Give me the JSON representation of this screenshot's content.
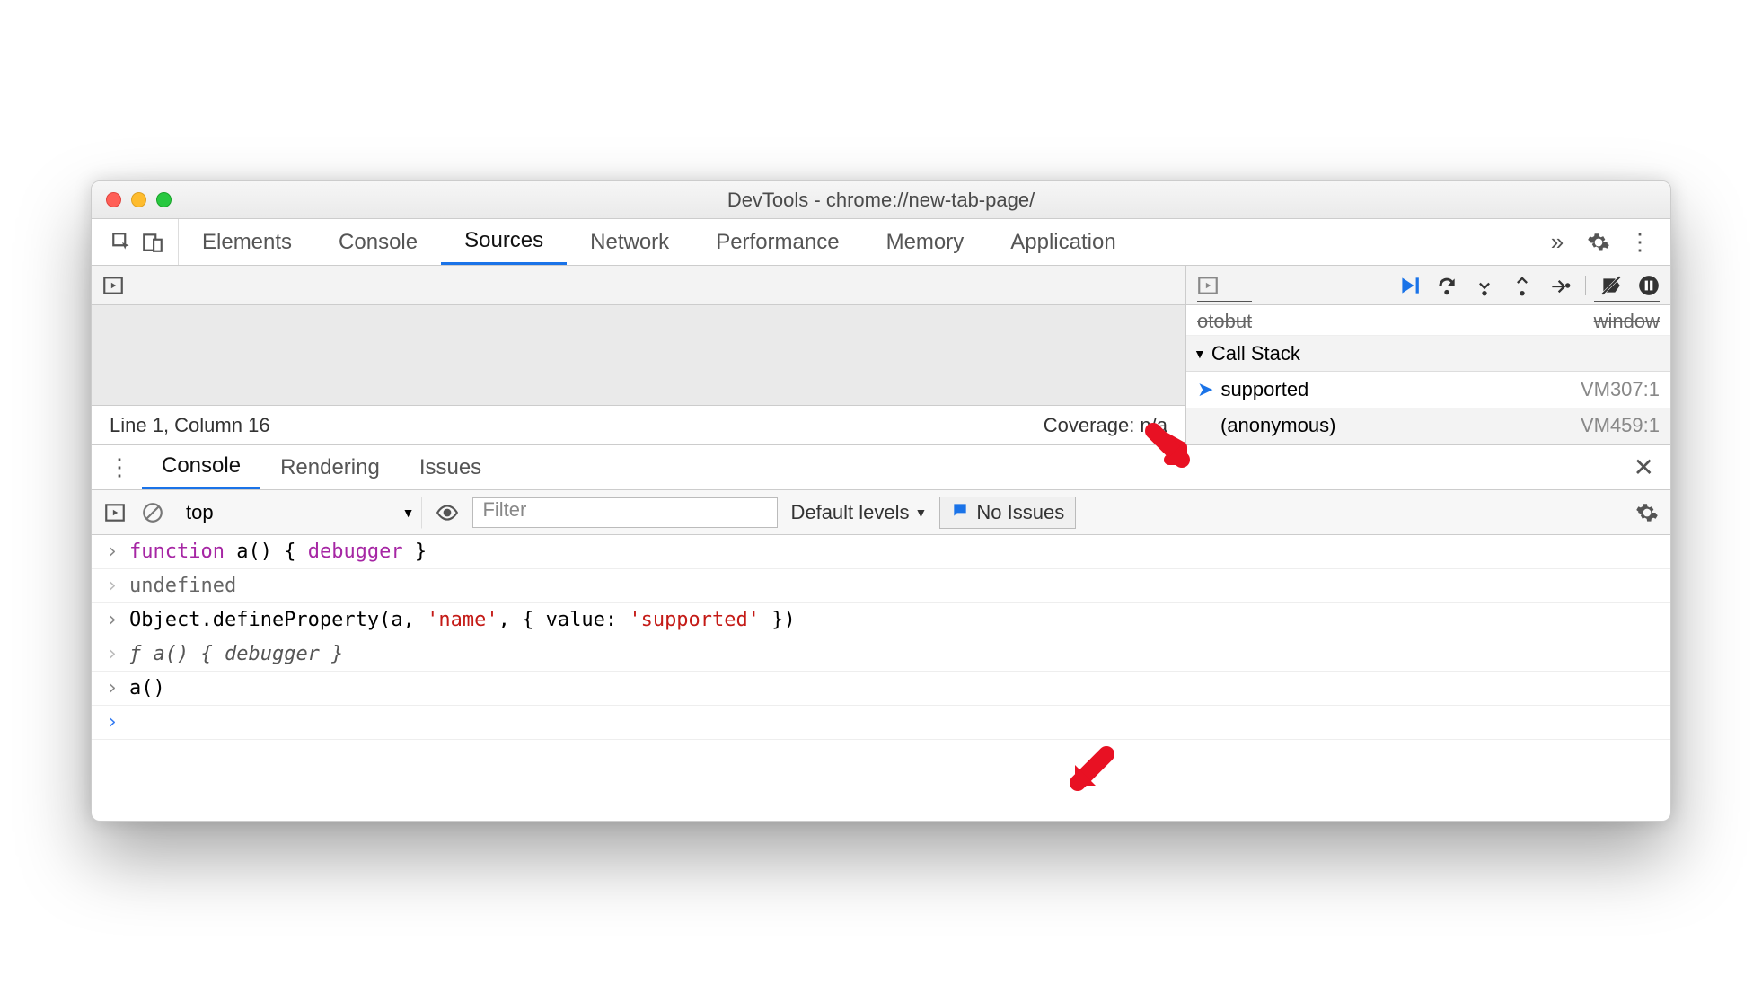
{
  "window": {
    "title": "DevTools - chrome://new-tab-page/"
  },
  "topTabs": {
    "items": [
      "Elements",
      "Console",
      "Sources",
      "Network",
      "Performance",
      "Memory",
      "Application"
    ],
    "activeIndex": 2,
    "overflow": "»"
  },
  "sources": {
    "statusLeft": "Line 1, Column 16",
    "statusRight": "Coverage: n/a",
    "partialLeft": "otobut",
    "partialRight": "window",
    "callStackTitle": "Call Stack",
    "frames": [
      {
        "name": "supported",
        "location": "VM307:1",
        "current": true
      },
      {
        "name": "(anonymous)",
        "location": "VM459:1",
        "current": false
      }
    ]
  },
  "drawerTabs": {
    "items": [
      "Console",
      "Rendering",
      "Issues"
    ],
    "activeIndex": 0
  },
  "consoleToolbar": {
    "context": "top",
    "contextCaret": "▼",
    "filterPlaceholder": "Filter",
    "levels": "Default levels",
    "levelsCaret": "▼",
    "issues": "No Issues"
  },
  "consoleLines": [
    {
      "type": "input",
      "segments": [
        {
          "t": "function ",
          "cls": "tk-keyword"
        },
        {
          "t": "a() { "
        },
        {
          "t": "debugger",
          "cls": "tk-debugger"
        },
        {
          "t": " }"
        }
      ]
    },
    {
      "type": "output",
      "segments": [
        {
          "t": "undefined",
          "cls": "tk-undef"
        }
      ]
    },
    {
      "type": "input",
      "segments": [
        {
          "t": "Object.defineProperty(a, "
        },
        {
          "t": "'name'",
          "cls": "tk-string"
        },
        {
          "t": ", { value: "
        },
        {
          "t": "'supported'",
          "cls": "tk-string"
        },
        {
          "t": " })"
        }
      ]
    },
    {
      "type": "output",
      "segments": [
        {
          "t": "ƒ ",
          "cls": "tk-italic"
        },
        {
          "t": "a() { debugger }",
          "cls": "tk-italic"
        }
      ]
    },
    {
      "type": "input",
      "segments": [
        {
          "t": "a()"
        }
      ]
    },
    {
      "type": "prompt",
      "segments": []
    }
  ]
}
